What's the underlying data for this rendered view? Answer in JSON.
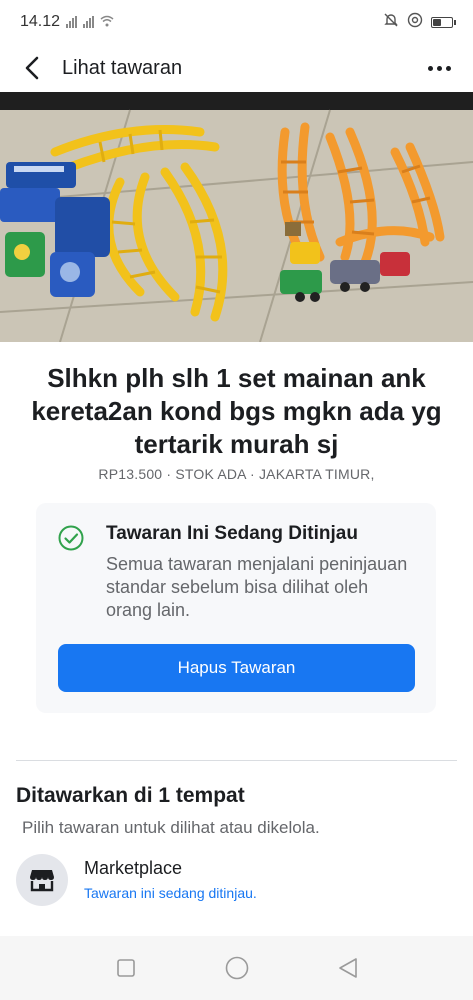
{
  "status_bar": {
    "time": "14.12",
    "icons": [
      "signal-icon",
      "signal-icon",
      "wifi-icon",
      "alarm-off-icon",
      "at-icon",
      "battery-icon"
    ],
    "battery_level": 0.45
  },
  "app_bar": {
    "title": "Lihat tawaran",
    "back_icon": "chevron-left-icon",
    "more_icon": "more-horizontal-icon"
  },
  "photo": {
    "page_count": 6,
    "current_page": 1
  },
  "listing": {
    "title": "Slhkn plh slh 1 set mainan ank kereta2an kond bgs mgkn ada yg tertarik murah sj",
    "meta": "RP13.500 · STOK ADA · JAKARTA TIMUR,"
  },
  "review_card": {
    "icon": "check-circle-icon",
    "title": "Tawaran Ini Sedang Ditinjau",
    "body": "Semua tawaran menjalani peninjauan standar sebelum bisa dilihat oleh orang lain.",
    "button_label": "Hapus Tawaran"
  },
  "offered": {
    "title": "Ditawarkan di 1 tempat",
    "subtitle": "Pilih tawaran untuk dilihat atau dikelola.",
    "places": [
      {
        "icon": "marketplace-shop-icon",
        "name": "Marketplace",
        "status": "Tawaran ini sedang ditinjau."
      }
    ]
  },
  "nav_bar": {
    "buttons": [
      "recents-square-icon",
      "home-circle-icon",
      "back-triangle-icon"
    ]
  },
  "colors": {
    "accent": "#1877f2",
    "check_green": "#31a24c",
    "card_bg": "#f7f8fa",
    "secondary_text": "#65676b"
  }
}
